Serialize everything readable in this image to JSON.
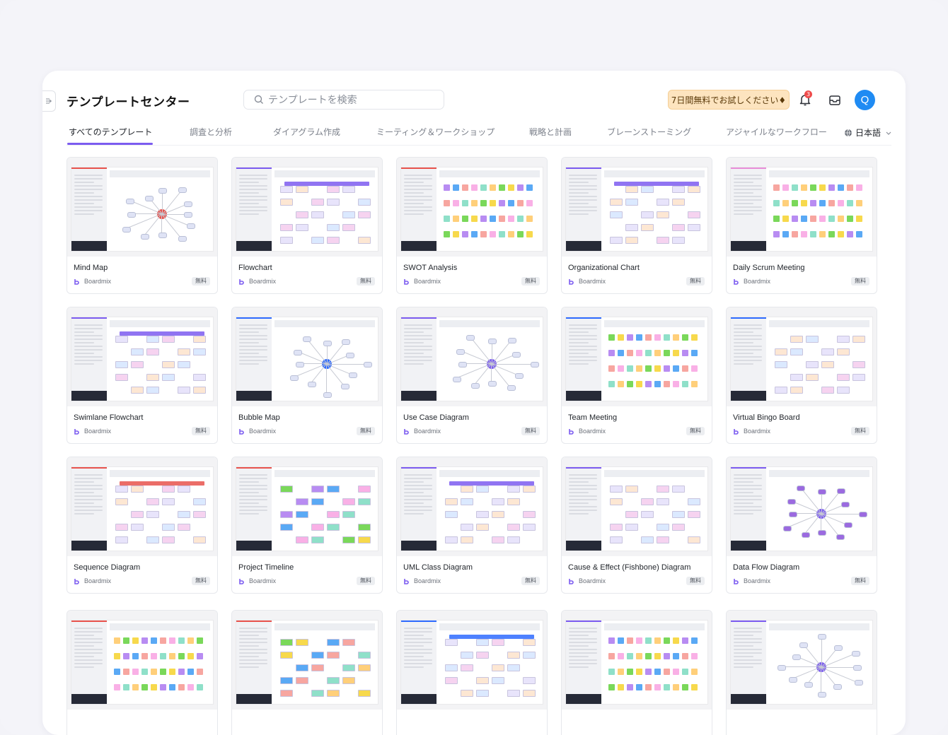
{
  "header": {
    "title": "テンプレートセンター",
    "search_placeholder": "テンプレートを検索",
    "trial_label": "7日間無料でお試しください♦",
    "notification_count": "3",
    "avatar_initial": "Q"
  },
  "tabs": [
    {
      "label": "すべてのテンプレート",
      "active": true
    },
    {
      "label": "調査と分析"
    },
    {
      "label": "ダイアグラム作成"
    },
    {
      "label": "ミーティング＆ワークショップ"
    },
    {
      "label": "戦略と計画"
    },
    {
      "label": "ブレーンストーミング"
    },
    {
      "label": "アジャイルなワークフロー"
    }
  ],
  "language": "日本語",
  "card_brand": "Boardmix",
  "card_badge": "無料",
  "cards": [
    {
      "title": "Mind Map",
      "style": "mind",
      "accent": "#e8534d"
    },
    {
      "title": "Flowchart",
      "style": "flow",
      "accent": "#7c5cf0"
    },
    {
      "title": "SWOT Analysis",
      "style": "swot",
      "accent": "#e8534d"
    },
    {
      "title": "Organizational Chart",
      "style": "org",
      "accent": "#7c5cf0"
    },
    {
      "title": "Daily Scrum Meeting",
      "style": "scrum",
      "accent": "#e88dd8"
    },
    {
      "title": "Swimlane Flowchart",
      "style": "swim",
      "accent": "#7c5cf0"
    },
    {
      "title": "Bubble Map",
      "style": "bubble",
      "accent": "#2f6bff"
    },
    {
      "title": "Use Case Diagram",
      "style": "usecase",
      "accent": "#7c5cf0"
    },
    {
      "title": "Team Meeting",
      "style": "team",
      "accent": "#2f6bff"
    },
    {
      "title": "Virtual Bingo Board",
      "style": "bingo",
      "accent": "#2f6bff"
    },
    {
      "title": "Sequence Diagram",
      "style": "seq",
      "accent": "#e8534d"
    },
    {
      "title": "Project Timeline",
      "style": "timeline",
      "accent": "#e8534d"
    },
    {
      "title": "UML Class Diagram",
      "style": "uml",
      "accent": "#7c5cf0"
    },
    {
      "title": "Cause & Effect (Fishbone) Diagram",
      "style": "fish",
      "accent": "#7c5cf0"
    },
    {
      "title": "Data Flow Diagram",
      "style": "dfd",
      "accent": "#7c5cf0"
    },
    {
      "title": "",
      "style": "kanban",
      "accent": "#e8534d"
    },
    {
      "title": "",
      "style": "plan",
      "accent": "#e8534d"
    },
    {
      "title": "",
      "style": "wbs",
      "accent": "#2f6bff"
    },
    {
      "title": "",
      "style": "matrix",
      "accent": "#7c5cf0"
    },
    {
      "title": "",
      "style": "tree",
      "accent": "#7c5cf0"
    }
  ],
  "colors": {
    "accent": "#7c5cf0",
    "trial_bg": "#fde4bf",
    "avatar": "#1f8bf3",
    "badge_red": "#ef4b4b"
  },
  "icons": [
    "collapse-sidebar-icon",
    "search-icon",
    "bell-icon",
    "inbox-icon",
    "globe-icon",
    "chevron-down-icon",
    "boardmix-logo-icon"
  ]
}
